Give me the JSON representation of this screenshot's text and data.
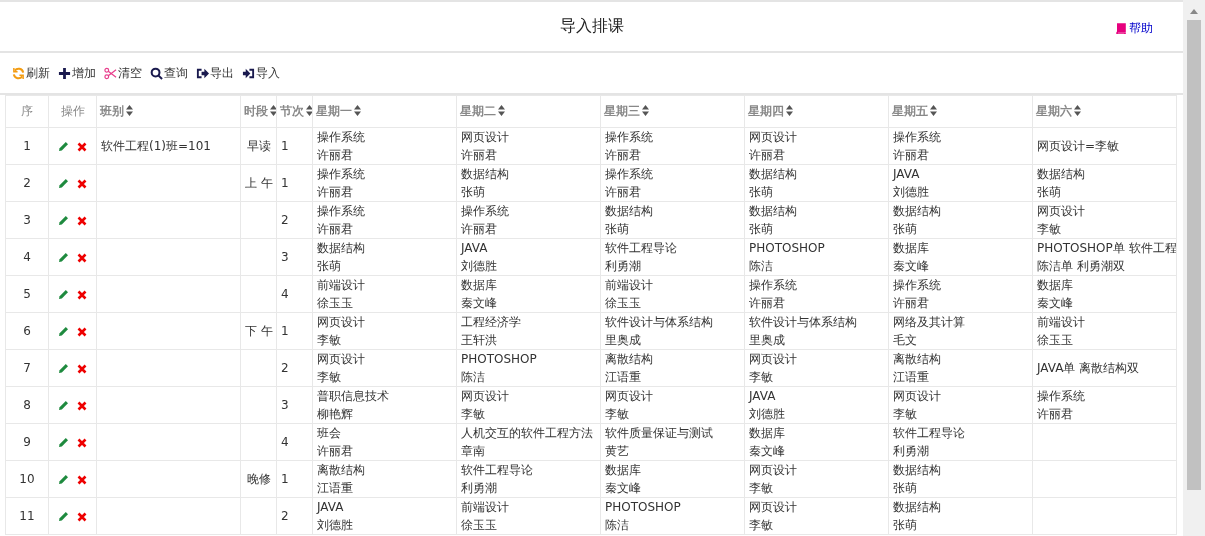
{
  "header": {
    "title": "导入排课",
    "help": "帮助"
  },
  "toolbar": [
    {
      "kind": "refresh",
      "label": "刷新"
    },
    {
      "kind": "add",
      "label": "增加"
    },
    {
      "kind": "clear",
      "label": "清空"
    },
    {
      "kind": "search",
      "label": "查询"
    },
    {
      "kind": "export",
      "label": "导出"
    },
    {
      "kind": "import",
      "label": "导入"
    }
  ],
  "table": {
    "columns": [
      {
        "label": "序",
        "sortable": false
      },
      {
        "label": "操作",
        "sortable": false
      },
      {
        "label": "班别",
        "sortable": true
      },
      {
        "label": "时段",
        "sortable": true
      },
      {
        "label": "节次",
        "sortable": true
      },
      {
        "label": "星期一",
        "sortable": true
      },
      {
        "label": "星期二",
        "sortable": true
      },
      {
        "label": "星期三",
        "sortable": true
      },
      {
        "label": "星期四",
        "sortable": true
      },
      {
        "label": "星期五",
        "sortable": true
      },
      {
        "label": "星期六",
        "sortable": true
      }
    ],
    "rows": [
      {
        "no": "1",
        "class": "软件工程(1)班=101",
        "period": "早读",
        "section": "1",
        "days": [
          [
            "操作系统",
            "许丽君"
          ],
          [
            "网页设计",
            "许丽君"
          ],
          [
            "操作系统",
            "许丽君"
          ],
          [
            "网页设计",
            "许丽君"
          ],
          [
            "操作系统",
            "许丽君"
          ],
          [
            "网页设计=李敏"
          ]
        ]
      },
      {
        "no": "2",
        "period": "上 午",
        "section": "1",
        "days": [
          [
            "操作系统",
            "许丽君"
          ],
          [
            "数据结构",
            "张萌"
          ],
          [
            "操作系统",
            "许丽君"
          ],
          [
            "数据结构",
            "张萌"
          ],
          [
            "JAVA",
            "刘德胜"
          ],
          [
            "数据结构",
            "张萌"
          ]
        ]
      },
      {
        "no": "3",
        "section": "2",
        "days": [
          [
            "操作系统",
            "许丽君"
          ],
          [
            "操作系统",
            "许丽君"
          ],
          [
            "数据结构",
            "张萌"
          ],
          [
            "数据结构",
            "张萌"
          ],
          [
            "数据结构",
            "张萌"
          ],
          [
            "网页设计",
            "李敏"
          ]
        ]
      },
      {
        "no": "4",
        "section": "3",
        "days": [
          [
            "数据结构",
            "张萌"
          ],
          [
            "JAVA",
            "刘德胜"
          ],
          [
            "软件工程导论",
            "利勇潮"
          ],
          [
            "PHOTOSHOP",
            "陈洁"
          ],
          [
            "数据库",
            "秦文峰"
          ],
          [
            "PHOTOSHOP单 软件工程",
            "陈洁单 利勇潮双"
          ]
        ]
      },
      {
        "no": "5",
        "section": "4",
        "days": [
          [
            "前端设计",
            "徐玉玉"
          ],
          [
            "数据库",
            "秦文峰"
          ],
          [
            "前端设计",
            "徐玉玉"
          ],
          [
            "操作系统",
            "许丽君"
          ],
          [
            "操作系统",
            "许丽君"
          ],
          [
            "数据库",
            "秦文峰"
          ]
        ]
      },
      {
        "no": "6",
        "period": "下 午",
        "section": "1",
        "days": [
          [
            "网页设计",
            "李敏"
          ],
          [
            "工程经济学",
            "王轩洪"
          ],
          [
            "软件设计与体系结构",
            "里奥成"
          ],
          [
            "软件设计与体系结构",
            "里奥成"
          ],
          [
            "网络及其计算",
            "毛文"
          ],
          [
            "前端设计",
            "徐玉玉"
          ]
        ]
      },
      {
        "no": "7",
        "section": "2",
        "days": [
          [
            "网页设计",
            "李敏"
          ],
          [
            "PHOTOSHOP",
            "陈洁"
          ],
          [
            "离散结构",
            "江语重"
          ],
          [
            "网页设计",
            "李敏"
          ],
          [
            "离散结构",
            "江语重"
          ],
          [
            "JAVA单 离散结构双"
          ]
        ]
      },
      {
        "no": "8",
        "section": "3",
        "days": [
          [
            "普职信息技术",
            "柳艳辉"
          ],
          [
            "网页设计",
            "李敏"
          ],
          [
            "网页设计",
            "李敏"
          ],
          [
            "JAVA",
            "刘德胜"
          ],
          [
            "网页设计",
            "李敏"
          ],
          [
            "操作系统",
            "许丽君"
          ]
        ]
      },
      {
        "no": "9",
        "section": "4",
        "days": [
          [
            "班会",
            "许丽君"
          ],
          [
            "人机交互的软件工程方法",
            "章南"
          ],
          [
            "软件质量保证与测试",
            "黄艺"
          ],
          [
            "数据库",
            "秦文峰"
          ],
          [
            "软件工程导论",
            "利勇潮"
          ]
        ]
      },
      {
        "no": "10",
        "period": "晚修",
        "section": "1",
        "days": [
          [
            "离散结构",
            "江语重"
          ],
          [
            "软件工程导论",
            "利勇潮"
          ],
          [
            "数据库",
            "秦文峰"
          ],
          [
            "网页设计",
            "李敏"
          ],
          [
            "数据结构",
            "张萌"
          ]
        ]
      },
      {
        "no": "11",
        "section": "2",
        "days": [
          [
            "JAVA",
            "刘德胜"
          ],
          [
            "前端设计",
            "徐玉玉"
          ],
          [
            "PHOTOSHOP",
            "陈洁"
          ],
          [
            "网页设计",
            "李敏"
          ],
          [
            "数据结构",
            "张萌"
          ]
        ]
      }
    ]
  }
}
